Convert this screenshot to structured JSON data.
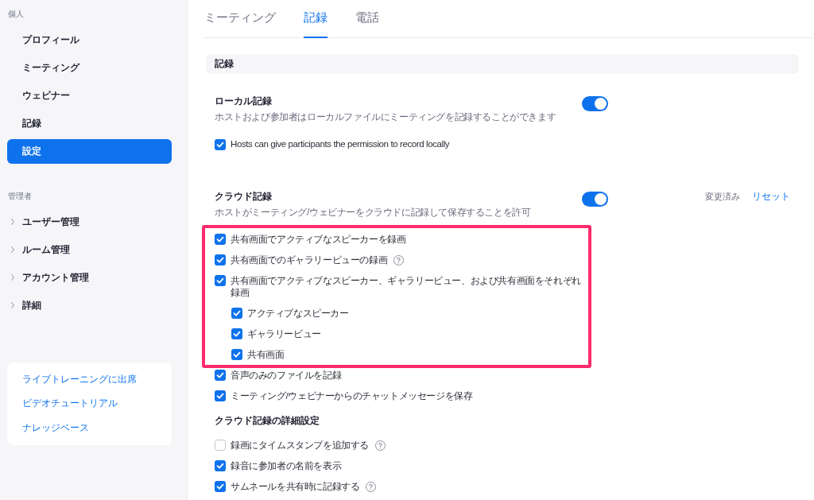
{
  "sidebar": {
    "sections": [
      {
        "heading": "個人",
        "items": [
          {
            "label": "プロフィール",
            "selected": false
          },
          {
            "label": "ミーティング",
            "selected": false
          },
          {
            "label": "ウェビナー",
            "selected": false
          },
          {
            "label": "記録",
            "selected": false
          },
          {
            "label": "設定",
            "selected": true
          }
        ]
      },
      {
        "heading": "管理者",
        "items": [
          {
            "label": "ユーザー管理",
            "expanded": false
          },
          {
            "label": "ルーム管理",
            "expanded": false
          },
          {
            "label": "アカウント管理",
            "expanded": false
          },
          {
            "label": "詳細",
            "expanded": false
          }
        ]
      }
    ],
    "links": [
      "ライブトレーニングに出席",
      "ビデオチュートリアル",
      "ナレッジベース"
    ]
  },
  "tabs": [
    {
      "label": "ミーティング",
      "selected": false
    },
    {
      "label": "記録",
      "selected": true
    },
    {
      "label": "電話",
      "selected": false
    }
  ],
  "section_header": "記録",
  "settings": [
    {
      "title": "ローカル記録",
      "description": "ホストおよび参加者はローカルファイルにミーティングを記録することができます",
      "on": true,
      "groups": [
        {
          "highlighted": false,
          "options": [
            {
              "label": "Hosts can give participants the permission to record locally",
              "checked": true,
              "help": false
            }
          ]
        }
      ]
    },
    {
      "title": "クラウド記録",
      "description": "ホストがミーティング/ウェビナーをクラウドに記録して保存することを許可",
      "on": true,
      "status": "変更済み",
      "reset": "リセット",
      "groups": [
        {
          "highlighted": true,
          "options": [
            {
              "label": "共有画面でアクティブなスピーカーを録画",
              "checked": true,
              "help": false
            },
            {
              "label": "共有画面でのギャラリービューの録画",
              "checked": true,
              "help": true
            },
            {
              "label": "共有画面でアクティブなスピーカー、ギャラリービュー、および共有画面をそれぞれ録画",
              "checked": true,
              "help": false,
              "children": [
                {
                  "label": "アクティブなスピーカー",
                  "checked": true,
                  "help": false
                },
                {
                  "label": "ギャラリービュー",
                  "checked": true,
                  "help": false
                },
                {
                  "label": "共有画面",
                  "checked": true,
                  "help": false
                }
              ]
            }
          ]
        },
        {
          "highlighted": false,
          "options": [
            {
              "label": "音声のみのファイルを記録",
              "checked": true,
              "help": false
            },
            {
              "label": "ミーティング/ウェビナーからのチャットメッセージを保存",
              "checked": true,
              "help": false
            }
          ]
        },
        {
          "highlighted": false,
          "heading": "クラウド記録の詳細設定",
          "options": [
            {
              "label": "録画にタイムスタンプを追加する",
              "checked": false,
              "help": true
            },
            {
              "label": "録音に参加者の名前を表示",
              "checked": true,
              "help": false
            },
            {
              "label": "サムネールを共有時に記録する",
              "checked": true,
              "help": true
            }
          ]
        }
      ]
    }
  ]
}
